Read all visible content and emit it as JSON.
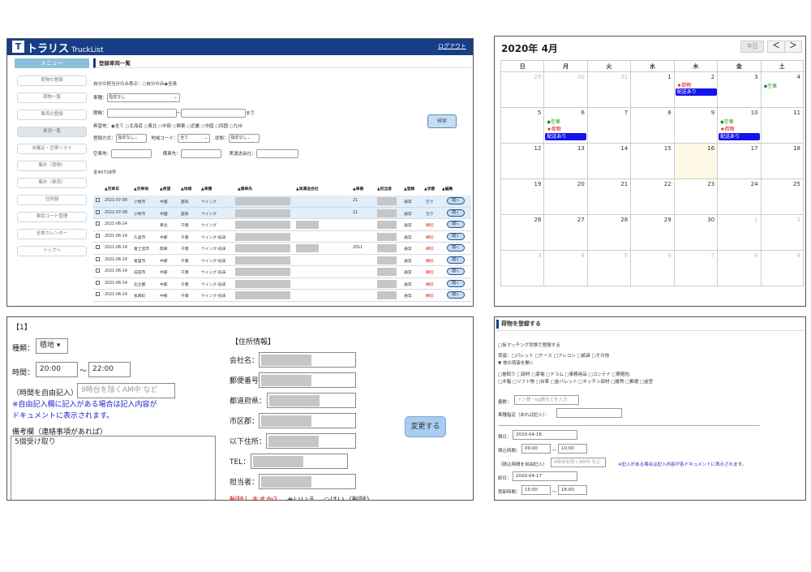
{
  "panel1": {
    "brand": "トラリス",
    "brand_sub": "TruckList",
    "logo_letter": "T",
    "logout": "ログアウト",
    "menu_header": "メニュー",
    "menu": [
      "荷物の登録",
      "荷物一覧",
      "車両の登録",
      "車両一覧",
      "未確定・空車リスト",
      "集計（荷物）",
      "集計（車両）",
      "住所録",
      "車両コード管理",
      "全体カレンダー",
      "トップへ"
    ],
    "page_title": "登録車両一覧",
    "own_only_label": "自分の担当分のみ表示：",
    "own_only_opt1": "○自分のみ",
    "own_only_opt2": "◉全員",
    "car_type_label": "車種：",
    "car_type_value": "指定なし",
    "period_label": "期間：",
    "period_sep": "～",
    "period_end": "まで",
    "region_label": "希望地：",
    "regions": "◉全て ○北海道 ○東北 ○中部 ○関東 ○近畿 ○中国 ○四国 ○九州",
    "reg_method_label": "登録方式：",
    "reg_method_value": "指定なし",
    "area_code_label": "地域コード：",
    "area_code_value": "全て",
    "status_label": "状態：",
    "status_value": "指定なし",
    "vacant_label": "空車地：",
    "prep_label": "備車先：",
    "transport_label": "実運送会社：",
    "search_button": "検索",
    "total": "全40728件",
    "columns": [
      "空車日",
      "空車地",
      "希望",
      "地域",
      "車種",
      "備車先",
      "実運送会社",
      "車番",
      "担当者",
      "登録",
      "状態",
      "編集"
    ],
    "rows": [
      {
        "date": "2021-07-08",
        "place": "小牧市",
        "hope": "中国",
        "area": "愛知",
        "type": "ウイング",
        "num": "21",
        "reg": "通常",
        "status": "空き"
      },
      {
        "date": "2021-07-08",
        "place": "小牧市",
        "hope": "中国",
        "area": "愛知",
        "type": "ウイング",
        "num": "21",
        "reg": "通常",
        "status": "空き"
      },
      {
        "date": "2021-06-24",
        "place": "",
        "hope": "東北",
        "area": "千葉",
        "type": "ウイング",
        "num": "",
        "reg": "通常",
        "status": "締切"
      },
      {
        "date": "2021-06-14",
        "place": "久喜市",
        "hope": "中部",
        "area": "千葉",
        "type": "ウイング-低床",
        "num": "",
        "reg": "通常",
        "status": "締切"
      },
      {
        "date": "2021-06-14",
        "place": "富士宮市",
        "hope": "関東",
        "area": "千葉",
        "type": "ウイング-低床",
        "num": "2011",
        "reg": "通常",
        "status": "締切"
      },
      {
        "date": "2021-06-14",
        "place": "富里市",
        "hope": "中部",
        "area": "千葉",
        "type": "ウイング-低床",
        "num": "",
        "reg": "通常",
        "status": "締切"
      },
      {
        "date": "2021-06-14",
        "place": "成田市",
        "hope": "中部",
        "area": "千葉",
        "type": "ウイング-低床",
        "num": "",
        "reg": "通常",
        "status": "締切"
      },
      {
        "date": "2021-06-14",
        "place": "北企都",
        "hope": "中部",
        "area": "千葉",
        "type": "ウイング-低床",
        "num": "",
        "reg": "通常",
        "status": "締切"
      },
      {
        "date": "2021-06-14",
        "place": "長南町",
        "hope": "中部",
        "area": "千葉",
        "type": "ウイング-低床",
        "num": "",
        "reg": "通常",
        "status": "締切"
      }
    ],
    "edit_label": "開く"
  },
  "panel2": {
    "title": "2020年 4月",
    "today_label": "今日",
    "prev": "＜",
    "next": "＞",
    "weekdays": [
      "日",
      "月",
      "火",
      "水",
      "木",
      "金",
      "土"
    ],
    "weeks": [
      [
        "29",
        "30",
        "31",
        "1",
        "2",
        "3",
        "4"
      ],
      [
        "5",
        "6",
        "7",
        "8",
        "9",
        "10",
        "11"
      ],
      [
        "12",
        "13",
        "14",
        "15",
        "16",
        "17",
        "18"
      ],
      [
        "19",
        "20",
        "21",
        "22",
        "23",
        "24",
        "25"
      ],
      [
        "26",
        "27",
        "28",
        "29",
        "30",
        "1",
        "2"
      ],
      [
        "3",
        "4",
        "5",
        "6",
        "7",
        "8",
        "9"
      ]
    ],
    "ev_kuusha": "◆空車",
    "ev_nimotsu": "★荷物",
    "ev_haisou": "配送あり"
  },
  "panel3": {
    "heading": "【1】",
    "type_label": "種類：",
    "type_value": "積地",
    "time_label": "時間：",
    "time_from": "20:00",
    "time_to": "22:00",
    "time_sep": "～",
    "free_label": "（時間を自由記入）",
    "free_placeholder": "9時台を除くAM中 など",
    "note1": "※自由記入欄に記入がある場合は記入内容が",
    "note2": "ドキュメントに表示されます。",
    "remarks_label": "備考欄（連絡事項があれば）",
    "remarks_value": "5個受け取り",
    "address_heading": "【住所情報】",
    "company_label": "会社名：",
    "zip_label": "郵便番号",
    "pref_label": "都道府県：",
    "city_label": "市区郡：",
    "addr_label": "以下住所：",
    "tel_label": "TEL：",
    "person_label": "担当者：",
    "delete_q": "削除しますか？",
    "delete_no": "◉いいえ",
    "delete_yes": "○はい（削除）",
    "change_button": "変更する"
  },
  "panel4": {
    "title": "荷物を登録する",
    "match_label": "□仮マッチング状態で登録する",
    "style_label": "荷姿：□パレット □ケース □フレコン □紙袋 □その他",
    "more_label": "▼ 他の荷姿を開く",
    "more_row1": "□巻取り □部材 □家電 □ドラム □事務用品 □コンテナ □剛梱包",
    "more_row2": "□木箱 □リフト物 □台車 □金パレット □キッチン部材 □雑貨 □郵便 □金型",
    "qty_label": "量数：",
    "qty_placeholder": "トン数・kg数などを入力",
    "car_label": "車種指定（あれば記入）：",
    "load_label": "積日：",
    "load_date": "2020-04-16",
    "load_time_label": "積込時間：",
    "load_from": "09:00",
    "load_to": "10:00",
    "sep": "～",
    "free_label": "（積込時間を自由記入）",
    "free_placeholder": "9時台を除くAM中 など",
    "free_note": "※記入がある場合は記入内容が各ドキュメントに表示されます。",
    "unload_label": "卸日：",
    "unload_date": "2020-04-17",
    "unload_time_label": "荷卸時間：",
    "unload_from": "15:00",
    "unload_to": "16:00"
  }
}
